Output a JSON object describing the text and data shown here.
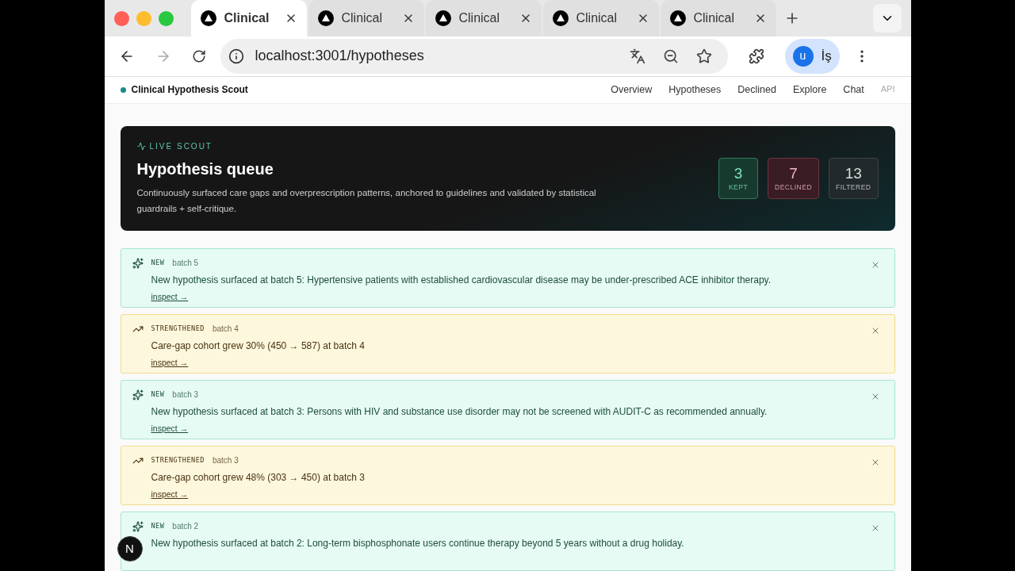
{
  "browser": {
    "tabs": [
      {
        "title": "Clinical",
        "selected": true
      },
      {
        "title": "Clinical",
        "selected": false
      },
      {
        "title": "Clinical",
        "selected": false
      },
      {
        "title": "Clinical",
        "selected": false
      },
      {
        "title": "Clinical",
        "selected": false
      }
    ],
    "url": "localhost:3001/hypotheses",
    "profile": {
      "avatar": "u",
      "label": "İş"
    }
  },
  "header": {
    "brand": "Clinical Hypothesis Scout",
    "nav": [
      {
        "label": "Overview",
        "disabled": false
      },
      {
        "label": "Hypotheses",
        "disabled": false
      },
      {
        "label": "Declined",
        "disabled": false
      },
      {
        "label": "Explore",
        "disabled": false
      },
      {
        "label": "Chat",
        "disabled": false
      },
      {
        "label": "API",
        "disabled": true
      }
    ]
  },
  "hero": {
    "eyebrow": "LIVE SCOUT",
    "title": "Hypothesis queue",
    "description": "Continuously surfaced care gaps and overprescription patterns, anchored to guidelines and validated by statistical guardrails + self-critique.",
    "stats": [
      {
        "kind": "kept",
        "value": "3",
        "label": "KEPT"
      },
      {
        "kind": "declined",
        "value": "7",
        "label": "DECLINED"
      },
      {
        "kind": "filtered",
        "value": "13",
        "label": "FILTERED"
      }
    ]
  },
  "events": [
    {
      "kind": "new",
      "tag": "NEW",
      "batch": "batch 5",
      "message": "New hypothesis surfaced at batch 5: Hypertensive patients with established cardiovascular disease may be under-prescribed ACE inhibitor therapy.",
      "link": "inspect →"
    },
    {
      "kind": "strengthened",
      "tag": "STRENGTHENED",
      "batch": "batch 4",
      "message": "Care-gap cohort grew 30% (450 → 587) at batch 4",
      "link": "inspect →"
    },
    {
      "kind": "new",
      "tag": "NEW",
      "batch": "batch 3",
      "message": "New hypothesis surfaced at batch 3: Persons with HIV and substance use disorder may not be screened with AUDIT-C as recommended annually.",
      "link": "inspect →"
    },
    {
      "kind": "strengthened",
      "tag": "STRENGTHENED",
      "batch": "batch 3",
      "message": "Care-gap cohort grew 48% (303 → 450) at batch 3",
      "link": "inspect →"
    },
    {
      "kind": "new",
      "tag": "NEW",
      "batch": "batch 2",
      "message": "New hypothesis surfaced at batch 2: Long-term bisphosphonate users continue therapy beyond 5 years without a drug holiday."
    }
  ],
  "dev_badge": "N"
}
